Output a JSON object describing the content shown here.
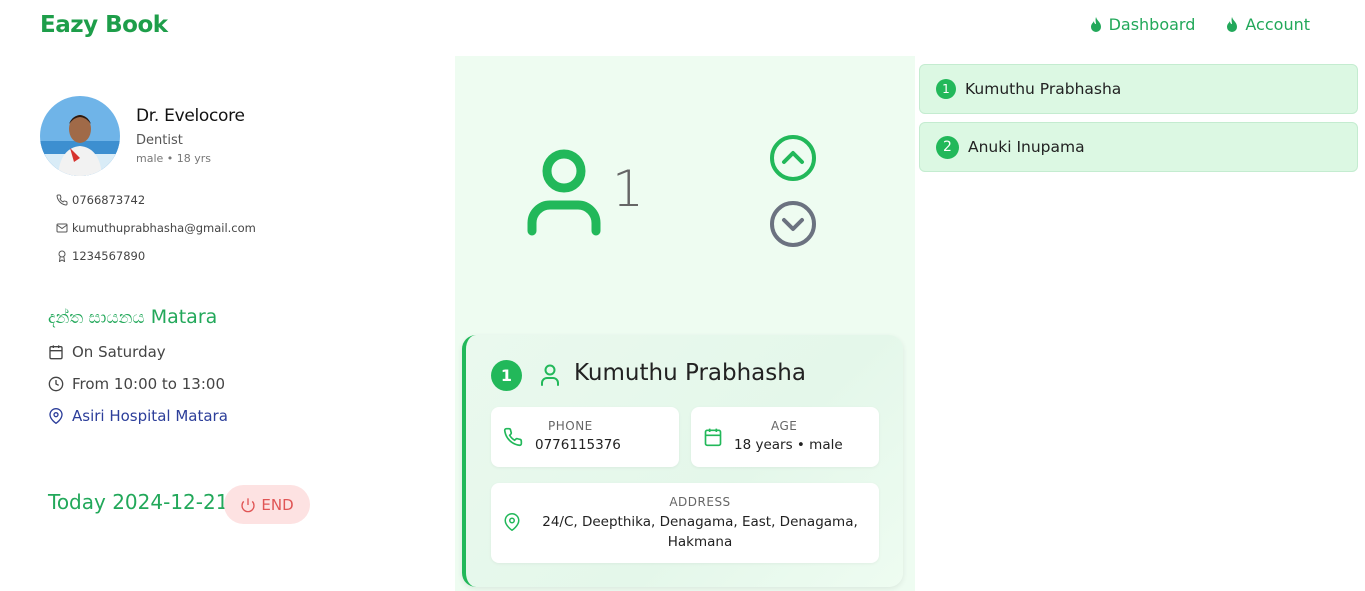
{
  "brand": "Eazy Book",
  "nav": [
    {
      "label": "Dashboard"
    },
    {
      "label": "Account"
    }
  ],
  "doctor": {
    "name": "Dr. Evelocore",
    "specialty": "Dentist",
    "meta": "male • 18 yrs",
    "phone": "0766873742",
    "email": "kumuthuprabhasha@gmail.com",
    "reg_no": "1234567890"
  },
  "clinic": {
    "title_si": "දන්ත සායනය",
    "title_place": "Matara",
    "day": "On Saturday",
    "time": "From 10:00 to 13:00",
    "location": "Asiri Hospital Matara"
  },
  "today": "Today 2024-12-21",
  "end_label": "END",
  "current_count": "1",
  "current_patient": {
    "number": "1",
    "name": "Kumuthu Prabhasha",
    "phone_label": "PHONE",
    "phone": "0776115376",
    "age_label": "AGE",
    "age": "18 years • male",
    "address_label": "ADDRESS",
    "address": "24/C, Deepthika, Denagama, East, Denagama, Hakmana"
  },
  "queue": [
    {
      "number": "1",
      "name": "Kumuthu Prabhasha"
    },
    {
      "number": "2",
      "name": "Anuki Inupama"
    }
  ],
  "colors": {
    "accent": "#22b85a",
    "brand": "#1e9e4a",
    "panel": "#eefcf1",
    "end_bg": "#fde2e2",
    "end_fg": "#e05555"
  }
}
